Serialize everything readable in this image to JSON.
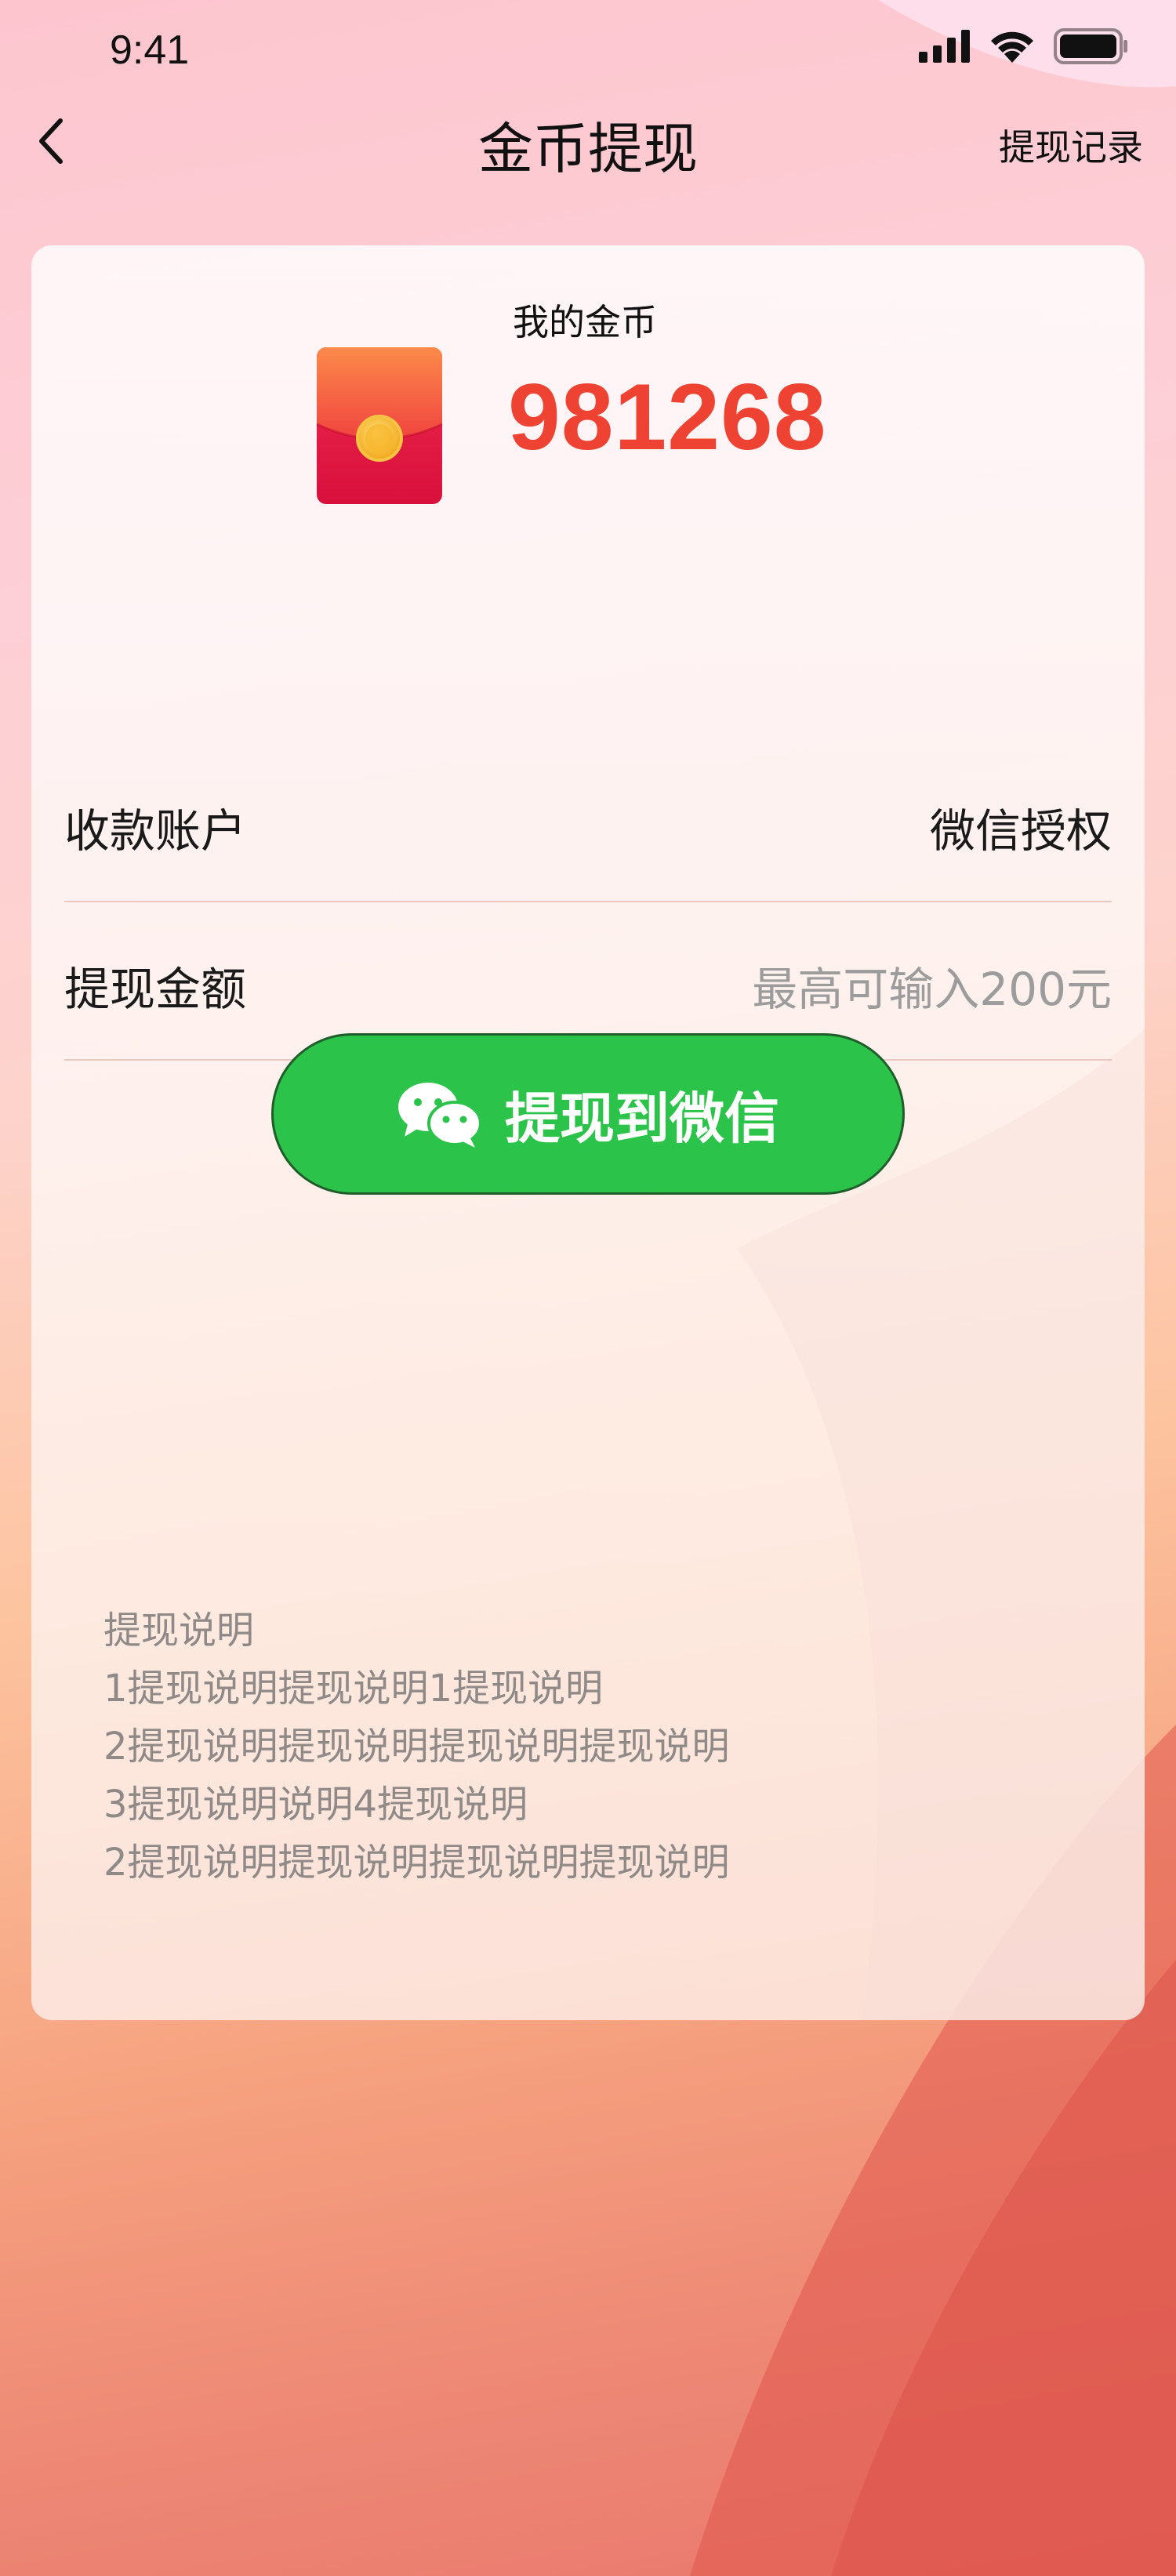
{
  "status_bar": {
    "time": "9:41",
    "icons": [
      "signal-icon",
      "wifi-icon",
      "battery-icon"
    ]
  },
  "nav": {
    "back_icon": "chevron-left-icon",
    "title": "金币提现",
    "record_label": "提现记录"
  },
  "coins": {
    "label": "我的金币",
    "value": "981268",
    "icon": "red-packet-icon"
  },
  "form": {
    "account_label": "收款账户",
    "account_value": "微信授权",
    "amount_label": "提现金额",
    "amount_placeholder": "最高可输入200元"
  },
  "action": {
    "icon": "wechat-icon",
    "label": "提现到微信"
  },
  "notes": {
    "lines": [
      "提现说明",
      "1提现说明提现说明1提现说明",
      "2提现说明提现说明提现说明提现说明",
      "3提现说明说明4提现说明",
      "2提现说明提现说明提现说明提现说明"
    ]
  },
  "colors": {
    "coin_value": "#ee4332",
    "button_green": "#2cc34a",
    "note_gray": "#8f8a88",
    "placeholder_gray": "#9c9c9c"
  }
}
